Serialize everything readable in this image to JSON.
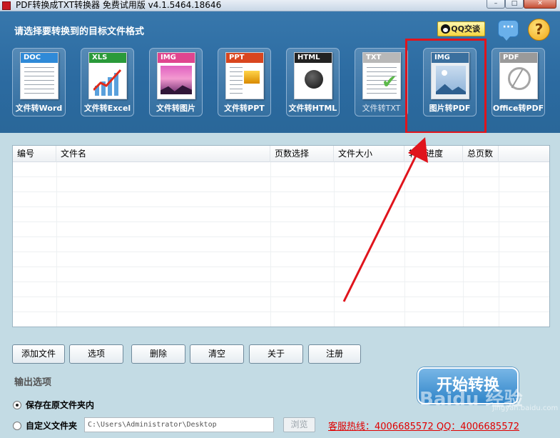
{
  "window": {
    "title": "PDF转换成TXT转换器 免费试用版 v4.1.5464.18646",
    "min_glyph": "–",
    "max_glyph": "□",
    "close_glyph": "✕"
  },
  "header": {
    "prompt": "请选择要转换到的目标文件格式",
    "qq_chat_label": "QQ交谈",
    "chat_glyph": "···",
    "help_glyph": "?"
  },
  "tools": [
    {
      "badge": "DOC",
      "label": "文件转Word",
      "badge_color": "#2f8ad8"
    },
    {
      "badge": "XLS",
      "label": "文件转Excel",
      "badge_color": "#2a9a3a"
    },
    {
      "badge": "IMG",
      "label": "文件转图片",
      "badge_color": "#e0468f"
    },
    {
      "badge": "PPT",
      "label": "文件转PPT",
      "badge_color": "#d9461f"
    },
    {
      "badge": "HTML",
      "label": "文件转HTML",
      "badge_color": "#222222"
    },
    {
      "badge": "TXT",
      "label": "文件转TXT",
      "badge_color": "#b8b8b8"
    },
    {
      "badge": "IMG",
      "label": "图片转PDF",
      "badge_color": "#3a6f9e"
    },
    {
      "badge": "PDF",
      "label": "Office转PDF",
      "badge_color": "#9a9a9a"
    }
  ],
  "table": {
    "columns": [
      "编号",
      "文件名",
      "页数选择",
      "文件大小",
      "转换进度",
      "总页数"
    ],
    "rows": []
  },
  "buttons": {
    "add_file": "添加文件",
    "options": "选项",
    "delete": "删除",
    "clear": "清空",
    "about": "关于",
    "register": "注册"
  },
  "output": {
    "section_label": "输出选项",
    "save_original": "保存在原文件夹内",
    "custom_folder": "自定义文件夹",
    "path_value": "C:\\Users\\Administrator\\Desktop",
    "browse": "浏览",
    "selected": "save_original"
  },
  "start_button": "开始转换",
  "hotline": "客服热线：4006685572 QQ：4006685572",
  "watermark": {
    "text": "Baidu 经验",
    "sub": "jingyan.baidu.com"
  },
  "colors": {
    "header_bg": "#2c6fa3",
    "panel_bg": "#c3dbe4",
    "highlight": "#e0141c",
    "hotline": "#e00000"
  }
}
